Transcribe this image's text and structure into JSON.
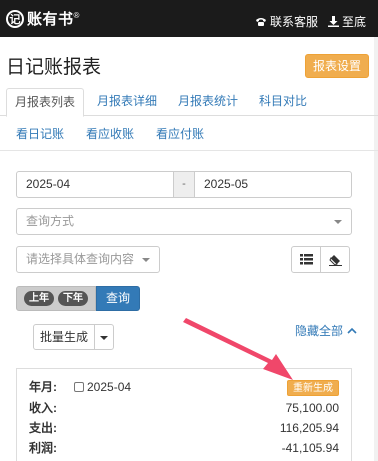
{
  "topbar": {
    "logo_mark": "记",
    "logo_text": "账有书",
    "logo_reg": "®",
    "contact_label": "联系客服",
    "bottom_label": "至底"
  },
  "header": {
    "title": "日记账报表",
    "settings_button": "报表设置"
  },
  "tabs": [
    {
      "label": "月报表列表",
      "active": true
    },
    {
      "label": "月报表详细",
      "active": false
    },
    {
      "label": "月报表统计",
      "active": false
    },
    {
      "label": "科目对比",
      "active": false
    }
  ],
  "sub_tabs": [
    {
      "label": "看日记账"
    },
    {
      "label": "看应收账"
    },
    {
      "label": "看应付账"
    }
  ],
  "filters": {
    "date_from": "2025-04",
    "date_sep": "-",
    "date_to": "2025-05",
    "query_method_placeholder": "查询方式",
    "detail_placeholder": "请选择具体查询内容",
    "year_pill": "上年",
    "month_pill": "下年",
    "query_button": "查询"
  },
  "actions": {
    "batch_generate": "批量生成",
    "hide_all": "隐藏全部"
  },
  "report": {
    "month_label": "年月:",
    "month_value": "2025-04",
    "regenerate": "重新生成",
    "income_label": "收入:",
    "income_value": "75,100.00",
    "expense_label": "支出:",
    "expense_value": "116,205.94",
    "profit_label": "利润:",
    "profit_value": "-41,105.94"
  },
  "colors": {
    "topbar": "#1b1b1b",
    "link": "#337ab7",
    "warning": "#f0ad4e",
    "arrow": "#f0476a"
  }
}
